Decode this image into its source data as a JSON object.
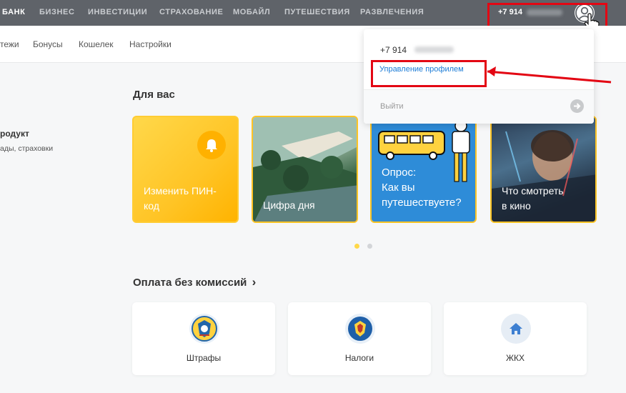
{
  "topnav": {
    "items": [
      {
        "label": "БАНК",
        "active": true
      },
      {
        "label": "БИЗНЕС",
        "active": false
      },
      {
        "label": "ИНВЕСТИЦИИ",
        "active": false
      },
      {
        "label": "СТРАХОВАНИЕ",
        "active": false
      },
      {
        "label": "МОБАЙЛ",
        "active": false
      },
      {
        "label": "ПУТЕШЕСТВИЯ",
        "active": false
      },
      {
        "label": "РАЗВЛЕЧЕНИЯ",
        "active": false
      }
    ],
    "phone": "+7 914",
    "avatar_icon": "user-icon",
    "cursor_icon": "hand-cursor-icon"
  },
  "subnav": {
    "items": [
      "тежи",
      "Бонусы",
      "Кошелек",
      "Настройки"
    ]
  },
  "left": {
    "title": "родукт",
    "subtitle": "ады, страховки"
  },
  "for_you": {
    "title": "Для вас",
    "cards": [
      {
        "label1": "Изменить ПИН-",
        "label2": "код",
        "icon": "bell-icon"
      },
      {
        "label1": "Цифра дня",
        "label2": ""
      },
      {
        "label1": "Опрос:",
        "label2": "Как вы",
        "label3": "путешествуете?",
        "icon": "bus-icon"
      },
      {
        "label1": "Что смотреть",
        "label2": "в кино"
      }
    ]
  },
  "payments": {
    "title": "Оплата без комиссий",
    "chevron": "›",
    "items": [
      {
        "label": "Штрафы",
        "icon": "traffic-police-emblem-icon"
      },
      {
        "label": "Налоги",
        "icon": "tax-emblem-icon"
      },
      {
        "label": "ЖКХ",
        "icon": "home-icon"
      }
    ]
  },
  "dropdown": {
    "phone": "+7 914",
    "manage_label": "Управление профилем",
    "logout_label": "Выйти",
    "logout_icon": "arrow-right-icon"
  },
  "colors": {
    "topnav_bg": "#5f6369",
    "accent_yellow": "#ffc425",
    "link_blue": "#1a7bd6",
    "annotation_red": "#e30613"
  }
}
